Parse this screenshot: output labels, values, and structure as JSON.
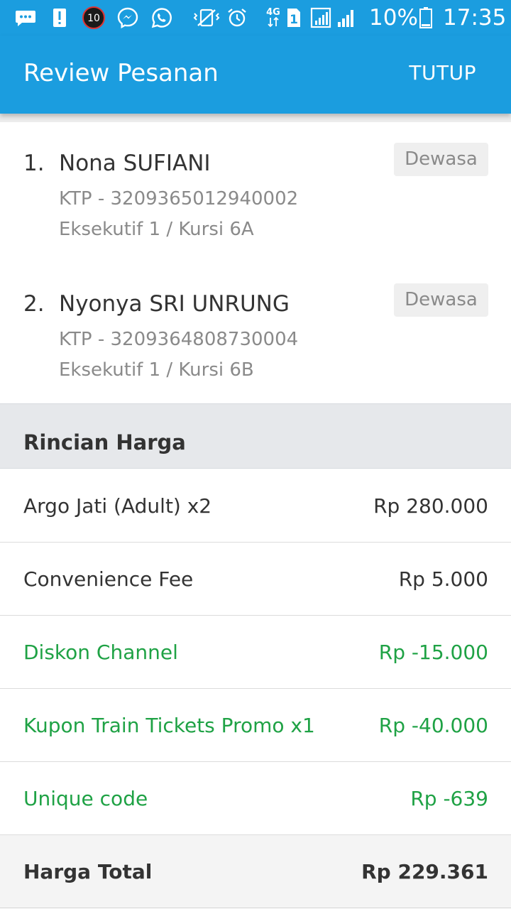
{
  "status_bar": {
    "notification_count": "10",
    "network_type": "4G",
    "sim_slot": "1",
    "battery_percent": "10%",
    "time": "17:35",
    "icons": [
      "message-icon",
      "alert-icon",
      "notification-count-icon",
      "messenger-icon",
      "whatsapp-icon",
      "vibrate-icon",
      "alarm-icon",
      "network-4g-icon",
      "sim-icon",
      "signal-icon",
      "signal-icon",
      "battery-icon"
    ]
  },
  "appbar": {
    "title": "Review Pesanan",
    "close_label": "TUTUP",
    "color": "#1b9ddf"
  },
  "passengers": [
    {
      "number": "1.",
      "name": "Nona SUFIANI",
      "id": "KTP - 3209365012940002",
      "seat": "Eksekutif 1 / Kursi 6A",
      "type": "Dewasa"
    },
    {
      "number": "2.",
      "name": "Nyonya SRI UNRUNG",
      "id": "KTP - 3209364808730004",
      "seat": "Eksekutif 1 / Kursi 6B",
      "type": "Dewasa"
    }
  ],
  "price": {
    "header": "Rincian Harga",
    "items": [
      {
        "label": "Argo Jati (Adult) x2",
        "value": "Rp 280.000"
      },
      {
        "label": "Convenience Fee",
        "value": "Rp 5.000"
      },
      {
        "label": "Diskon Channel",
        "value": "Rp -15.000"
      },
      {
        "label": "Kupon Train Tickets Promo x1",
        "value": "Rp -40.000"
      },
      {
        "label": "Unique code",
        "value": "Rp -639"
      }
    ],
    "total": {
      "label": "Harga Total",
      "value": "Rp 229.361"
    },
    "discount_color": "#1fa245"
  }
}
